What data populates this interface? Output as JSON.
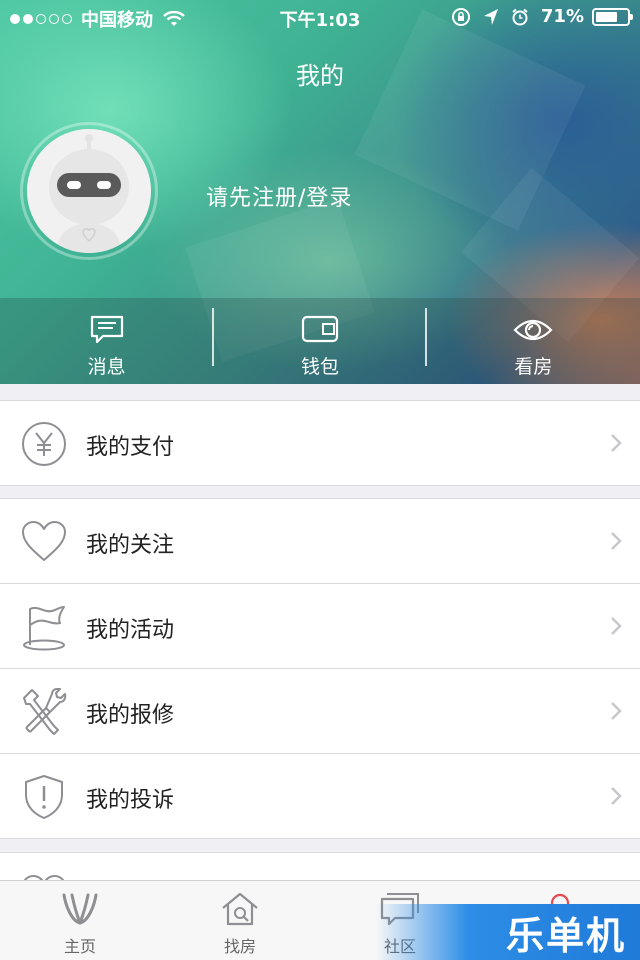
{
  "status_bar": {
    "carrier": "中国移动",
    "time": "下午1:03",
    "battery_percent": "71%",
    "battery_level": 0.71,
    "signal_bars_filled": 2,
    "signal_bars_total": 5
  },
  "header": {
    "title": "我的",
    "login_prompt": "请先注册/登录"
  },
  "quick_actions": [
    {
      "label": "消息",
      "icon": "message-icon"
    },
    {
      "label": "钱包",
      "icon": "wallet-icon"
    },
    {
      "label": "看房",
      "icon": "eye-icon"
    }
  ],
  "menu": {
    "payment": "我的支付",
    "follow": "我的关注",
    "activity": "我的活动",
    "repair": "我的报修",
    "complaint": "我的投诉"
  },
  "tabs": [
    {
      "label": "主页",
      "icon": "home-logo-icon"
    },
    {
      "label": "找房",
      "icon": "house-search-icon"
    },
    {
      "label": "社区",
      "icon": "community-chat-icon"
    },
    {
      "label": "",
      "icon": "profile-icon"
    }
  ],
  "watermark": "乐单机",
  "colors": {
    "accent_gray": "#8e8e93",
    "header_green": "#4fc8a3",
    "watermark_blue": "#2d8de6"
  }
}
